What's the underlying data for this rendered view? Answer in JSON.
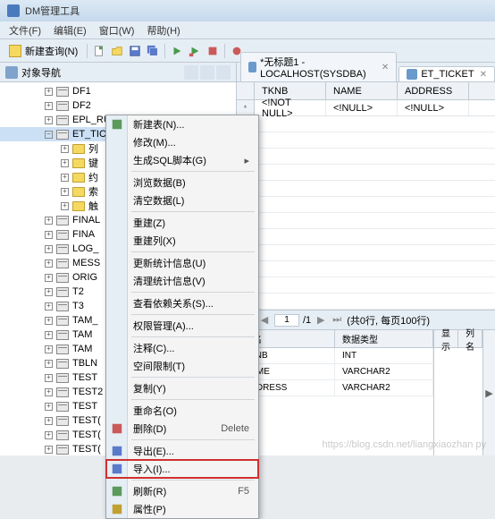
{
  "window": {
    "title": "DM管理工具"
  },
  "menubar": {
    "file": "文件(F)",
    "edit": "编辑(E)",
    "window": "窗口(W)",
    "help": "帮助(H)"
  },
  "toolbar": {
    "new_query": "新建查询(N)"
  },
  "sidebar": {
    "title": "对象导航",
    "nodes": [
      {
        "label": "DF1",
        "type": "table"
      },
      {
        "label": "DF2",
        "type": "table"
      },
      {
        "label": "EPL_RULE_EMERGENCY",
        "type": "table"
      },
      {
        "label": "ET_TICKET",
        "type": "table",
        "expanded": true,
        "selected": true
      },
      {
        "label": "列",
        "type": "folder",
        "indent": 1
      },
      {
        "label": "键",
        "type": "folder",
        "indent": 1
      },
      {
        "label": "约",
        "type": "folder",
        "indent": 1
      },
      {
        "label": "索",
        "type": "folder",
        "indent": 1
      },
      {
        "label": "触",
        "type": "folder",
        "indent": 1
      },
      {
        "label": "FINAL",
        "type": "table"
      },
      {
        "label": "FINA",
        "type": "table"
      },
      {
        "label": "LOG_",
        "type": "table"
      },
      {
        "label": "MESS",
        "type": "table"
      },
      {
        "label": "ORIG",
        "type": "table"
      },
      {
        "label": "T2",
        "type": "table"
      },
      {
        "label": "T3",
        "type": "table"
      },
      {
        "label": "TAM_",
        "type": "table"
      },
      {
        "label": "TAM",
        "type": "table"
      },
      {
        "label": "TAM",
        "type": "table"
      },
      {
        "label": "TBLN",
        "type": "table"
      },
      {
        "label": "TEST",
        "type": "table"
      },
      {
        "label": "TEST2",
        "type": "table"
      },
      {
        "label": "TEST",
        "type": "table"
      },
      {
        "label": "TEST(",
        "type": "table"
      },
      {
        "label": "TEST(",
        "type": "table"
      },
      {
        "label": "TEST(",
        "type": "table"
      },
      {
        "label": "TEST(",
        "type": "table"
      },
      {
        "label": "TEST(",
        "type": "table"
      }
    ]
  },
  "context_menu": {
    "items": [
      {
        "label": "新建表(N)...",
        "icon": "new"
      },
      {
        "label": "修改(M)..."
      },
      {
        "label": "生成SQL脚本(G)",
        "submenu": true
      },
      {
        "sep": true
      },
      {
        "label": "浏览数据(B)"
      },
      {
        "label": "清空数据(L)"
      },
      {
        "sep": true
      },
      {
        "label": "重建(Z)"
      },
      {
        "label": "重建列(X)"
      },
      {
        "sep": true
      },
      {
        "label": "更新统计信息(U)"
      },
      {
        "label": "清理统计信息(V)"
      },
      {
        "sep": true
      },
      {
        "label": "查看依赖关系(S)..."
      },
      {
        "sep": true
      },
      {
        "label": "权限管理(A)..."
      },
      {
        "sep": true
      },
      {
        "label": "注释(C)..."
      },
      {
        "label": "空间限制(T)"
      },
      {
        "sep": true
      },
      {
        "label": "复制(Y)"
      },
      {
        "sep": true
      },
      {
        "label": "重命名(O)"
      },
      {
        "label": "删除(D)",
        "icon": "delete",
        "shortcut": "Delete"
      },
      {
        "sep": true
      },
      {
        "label": "导出(E)...",
        "icon": "export"
      },
      {
        "label": "导入(I)...",
        "icon": "import",
        "highlighted": true
      },
      {
        "sep": true
      },
      {
        "label": "刷新(R)",
        "icon": "refresh",
        "shortcut": "F5"
      },
      {
        "label": "属性(P)",
        "icon": "properties"
      }
    ]
  },
  "tabs": [
    {
      "label": "*无标题1 - LOCALHOST(SYSDBA)",
      "active": false
    },
    {
      "label": "ET_TICKET",
      "active": true
    }
  ],
  "grid": {
    "columns": [
      "TKNB",
      "NAME",
      "ADDRESS"
    ],
    "rows": [
      {
        "rownum": "*",
        "cells": [
          "<!NOT NULL>",
          "<!NULL>",
          "<!NULL>"
        ]
      }
    ]
  },
  "pager": {
    "page": "1",
    "total": "/1",
    "info": "(共0行, 每页100行)"
  },
  "bottom_grid": {
    "left_headers": [
      "列名",
      "数据类型"
    ],
    "right_headers": [
      "显示",
      "列名"
    ],
    "rows": [
      {
        "col": "TKNB",
        "type": "INT"
      },
      {
        "col": "NAME",
        "type": "VARCHAR2"
      },
      {
        "col": "ADDRESS",
        "type": "VARCHAR2"
      }
    ]
  },
  "watermark": "https://blog.csdn.net/liangxiaozhan py"
}
